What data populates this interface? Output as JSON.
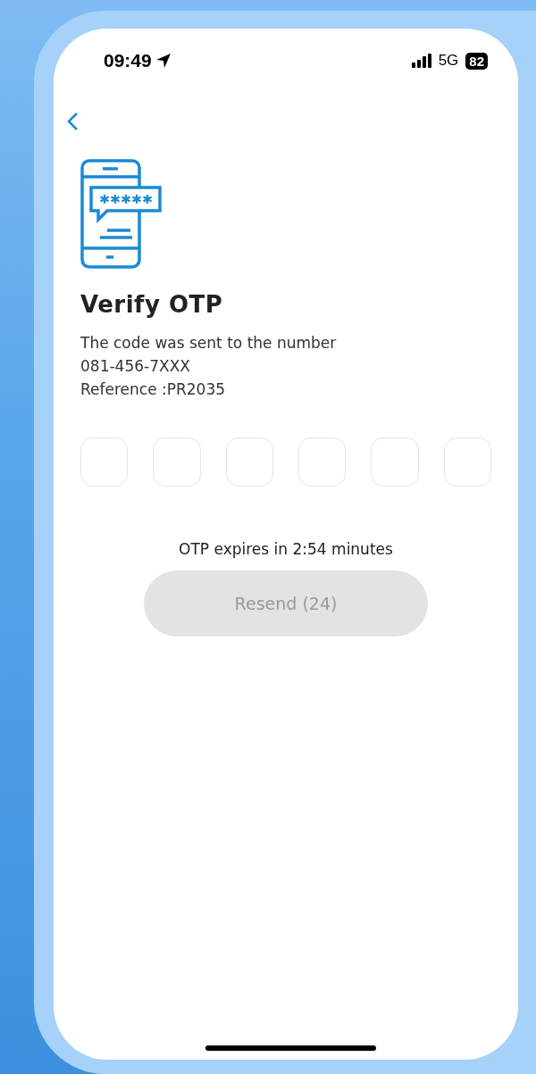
{
  "status_bar": {
    "time": "09:49",
    "network": "5G",
    "battery": "82"
  },
  "title": "Verify OTP",
  "description": [
    "The code was sent to the number",
    "081-456-7XXX",
    "Reference :PR2035"
  ],
  "otp_fields": [
    {
      "filled": false
    },
    {
      "filled": false
    },
    {
      "filled": false
    },
    {
      "filled": false
    },
    {
      "filled": false
    },
    {
      "filled": false
    }
  ],
  "expiry": "OTP expires in 2:54 minutes",
  "resend_button": {
    "label": "Resend (24)",
    "disabled": true
  }
}
